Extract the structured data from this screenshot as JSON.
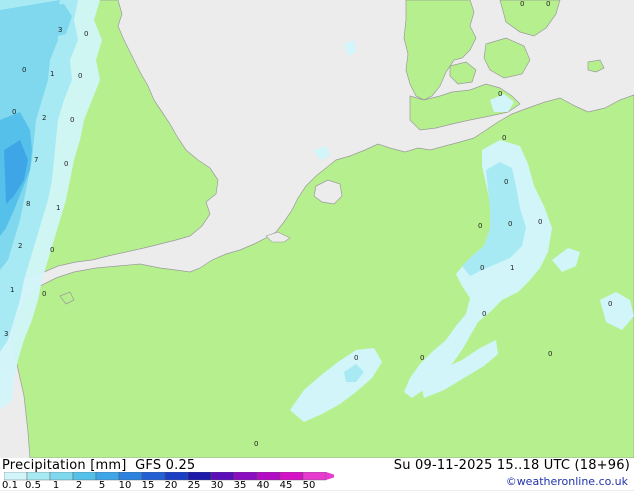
{
  "header": {
    "left_label": "Precipitation [mm]",
    "model": "GFS 0.25",
    "datetime": "Su 09-11-2025 15..18 UTC (18+96)"
  },
  "footer": {
    "copyright": "weatheronline.co.uk"
  },
  "legend": {
    "ticks": [
      "0.1",
      "0.5",
      "1",
      "2",
      "5",
      "10",
      "15",
      "20",
      "25",
      "30",
      "35",
      "40",
      "45",
      "50"
    ],
    "colors": [
      "#d2f5fa",
      "#a8eaf3",
      "#7fd8ee",
      "#55c1ea",
      "#3ea6e6",
      "#2c82df",
      "#2260d4",
      "#1b3fc4",
      "#1c1aa8",
      "#5a0fb8",
      "#8a0dc0",
      "#b40cc4",
      "#d412c6",
      "#e63cd0"
    ]
  },
  "colors": {
    "land": "#b6f08e",
    "sea": "#ececec",
    "border": "#9a9a9a"
  },
  "map_values": [
    "3",
    "0",
    "0",
    "1",
    "0",
    "0",
    "2",
    "0",
    "7",
    "0",
    "8",
    "1",
    "2",
    "0",
    "1",
    "0",
    "3",
    "0",
    "0",
    "0",
    "0",
    "0",
    "0",
    "0",
    "1",
    "0",
    "0",
    "0",
    "0",
    "0",
    "0"
  ]
}
